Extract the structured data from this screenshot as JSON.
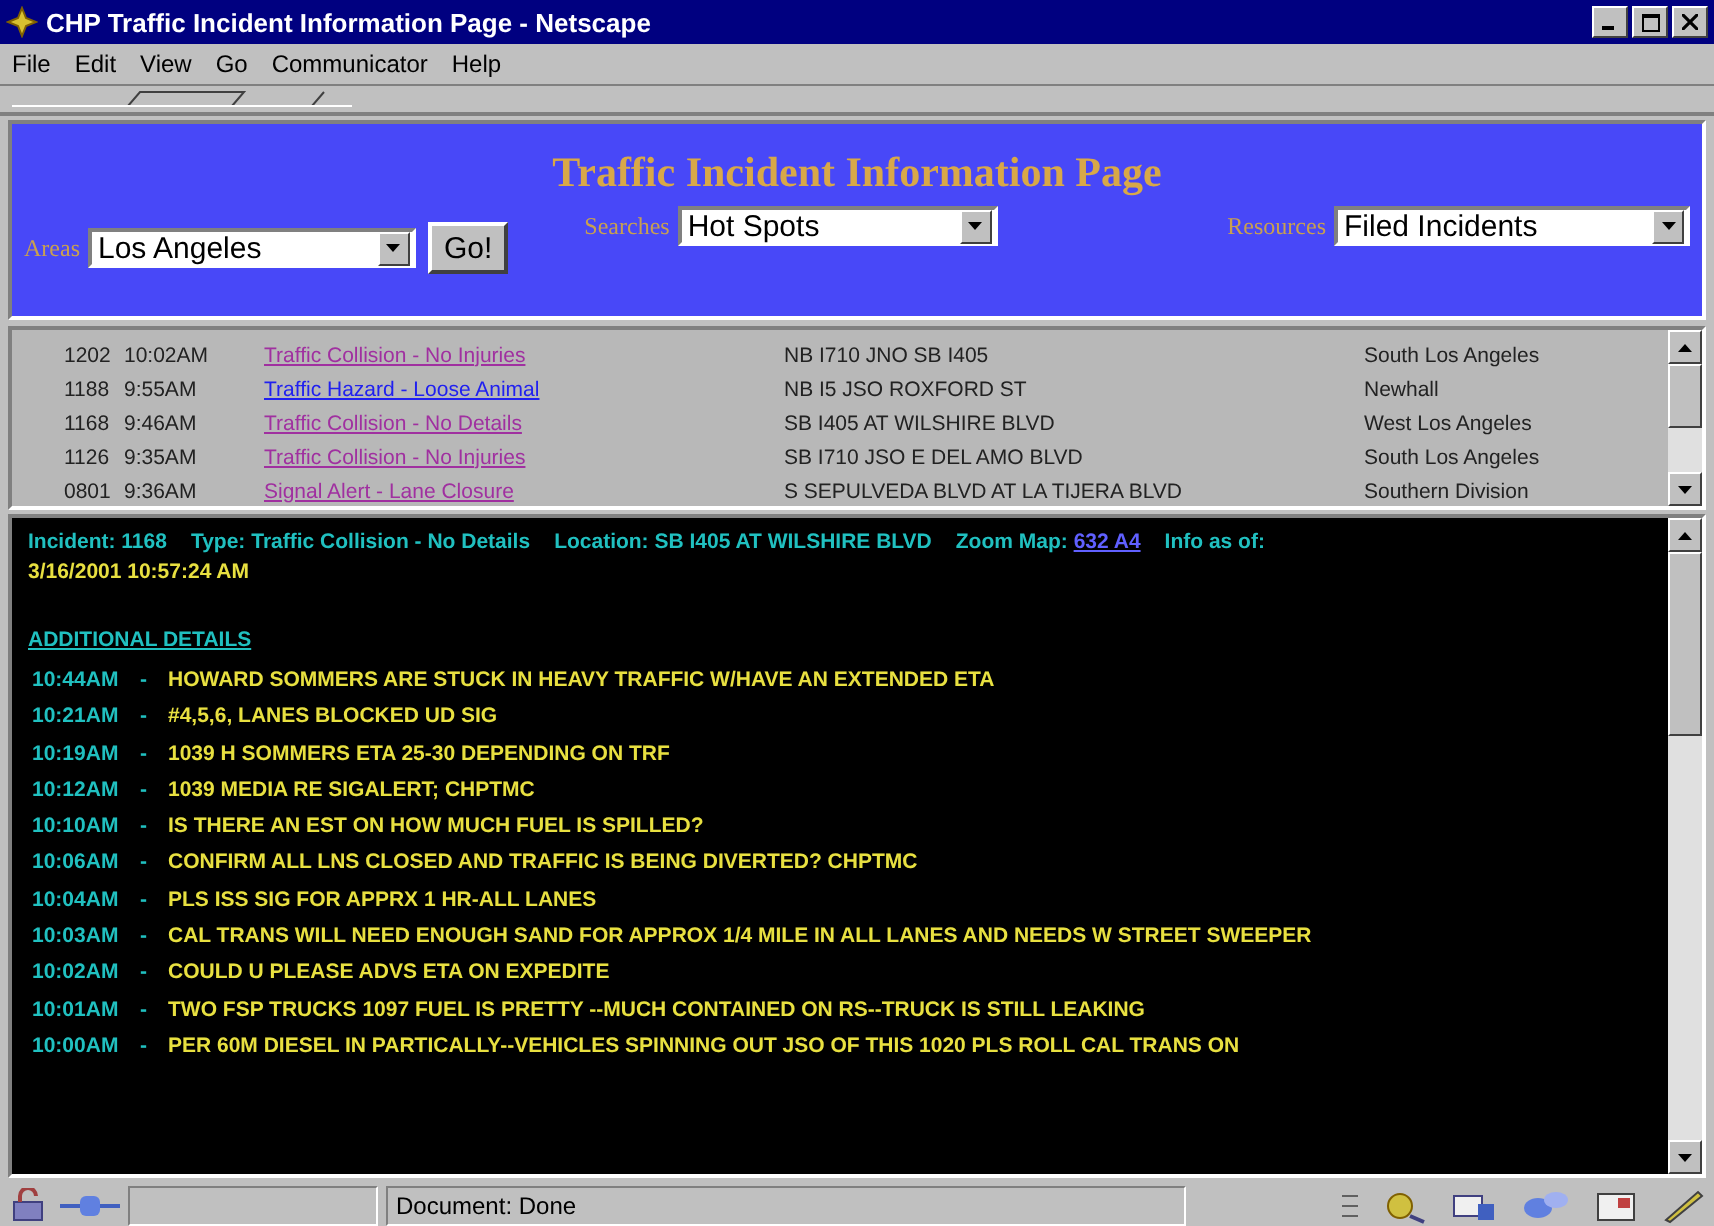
{
  "window": {
    "title": "CHP Traffic Incident Information Page - Netscape"
  },
  "menu": [
    "File",
    "Edit",
    "View",
    "Go",
    "Communicator",
    "Help"
  ],
  "header": {
    "title": "Traffic Incident Information Page",
    "area": {
      "label": "Areas",
      "value": "Los Angeles"
    },
    "go_button": "Go!",
    "searches": {
      "label": "Searches",
      "value": "Hot Spots"
    },
    "resources": {
      "label": "Resources",
      "value": "Filed Incidents"
    }
  },
  "incidents": [
    {
      "number": "1202",
      "time": "10:02AM",
      "type": "Traffic Collision - No Injuries",
      "visited": true,
      "location": "NB I710 JNO SB I405",
      "area": "South Los Angeles"
    },
    {
      "number": "1188",
      "time": "9:55AM",
      "type": "Traffic Hazard - Loose Animal",
      "visited": false,
      "location": "NB I5 JSO ROXFORD ST",
      "area": "Newhall"
    },
    {
      "number": "1168",
      "time": "9:46AM",
      "type": "Traffic Collision - No Details",
      "visited": true,
      "location": "SB I405 AT WILSHIRE BLVD",
      "area": "West Los Angeles"
    },
    {
      "number": "1126",
      "time": "9:35AM",
      "type": "Traffic Collision - No Injuries",
      "visited": true,
      "location": "SB I710 JSO E DEL AMO BLVD",
      "area": "South Los Angeles"
    },
    {
      "number": "0801",
      "time": "9:36AM",
      "type": "Signal Alert - Lane Closure",
      "visited": true,
      "location": "S SEPULVEDA BLVD AT LA TIJERA BLVD",
      "area": "Southern Division"
    }
  ],
  "detail": {
    "fields": [
      {
        "label": "Incident:",
        "value": "1168"
      },
      {
        "label": "Type:",
        "value": "Traffic Collision - No Details"
      },
      {
        "label": "Location:",
        "value": "SB I405 AT WILSHIRE BLVD"
      }
    ],
    "map": {
      "label": "Zoom Map:",
      "link": "632 A4"
    },
    "info_label": "Info as of:",
    "timestamp": "3/16/2001 10:57:24 AM",
    "section_title": "ADDITIONAL DETAILS",
    "log": [
      {
        "time": "10:44AM",
        "dash": "-",
        "text": "HOWARD SOMMERS ARE STUCK IN HEAVY TRAFFIC W/HAVE AN EXTENDED ETA"
      },
      {
        "time": "10:21AM",
        "dash": "-",
        "text": "#4,5,6, LANES BLOCKED UD SIG"
      },
      {
        "time": "10:19AM",
        "dash": "-",
        "text": "1039 H SOMMERS ETA 25-30 DEPENDING ON TRF"
      },
      {
        "time": "10:12AM",
        "dash": "-",
        "text": "1039 MEDIA RE SIGALERT; CHPTMC"
      },
      {
        "time": "10:10AM",
        "dash": "-",
        "text": "IS THERE AN EST ON HOW MUCH FUEL IS SPILLED?"
      },
      {
        "time": "10:06AM",
        "dash": "-",
        "text": "CONFIRM ALL LNS CLOSED AND TRAFFIC IS BEING DIVERTED? CHPTMC"
      },
      {
        "time": "10:04AM",
        "dash": "-",
        "text": "PLS ISS SIG FOR APPRX 1 HR-ALL LANES"
      },
      {
        "time": "10:03AM",
        "dash": "-",
        "text": "CAL TRANS WILL NEED ENOUGH SAND FOR APPROX 1/4 MILE IN ALL LANES AND NEEDS W STREET SWEEPER"
      },
      {
        "time": "10:02AM",
        "dash": "-",
        "text": "COULD U PLEASE ADVS ETA ON EXPEDITE"
      },
      {
        "time": "10:01AM",
        "dash": "-",
        "text": "TWO FSP TRUCKS 1097 FUEL IS PRETTY --MUCH CONTAINED ON RS--TRUCK IS STILL LEAKING"
      },
      {
        "time": "10:00AM",
        "dash": "-",
        "text": "PER 60M DIESEL IN PARTICALLY--VEHICLES SPINNING OUT JSO OF THIS 1020 PLS ROLL CAL TRANS ON"
      }
    ]
  },
  "status_bar": {
    "text": "Document: Done"
  }
}
